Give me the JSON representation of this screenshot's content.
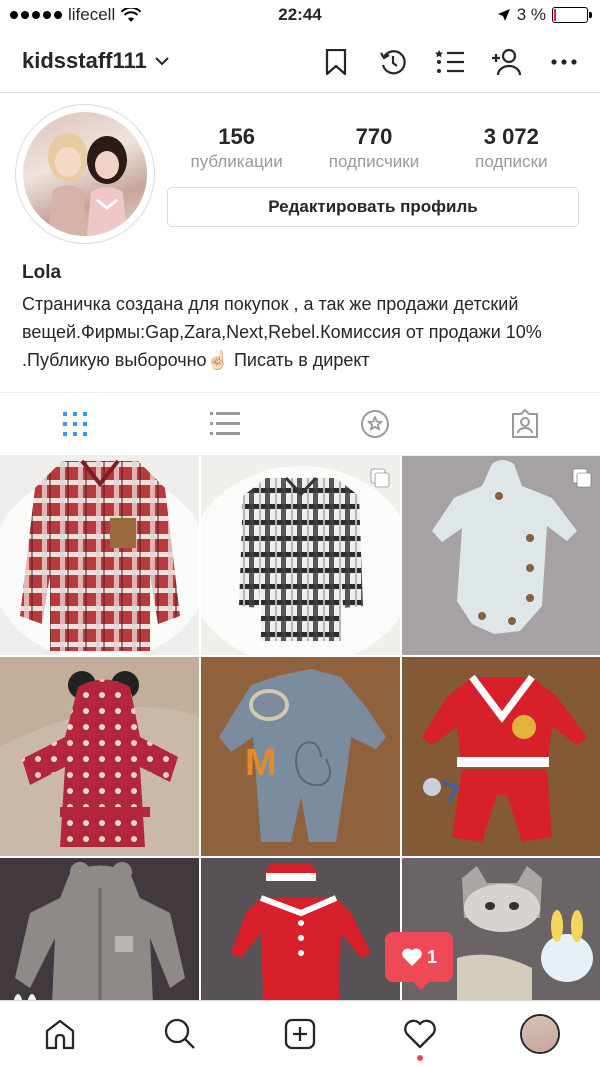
{
  "status_bar": {
    "carrier": "lifecell",
    "time": "22:44",
    "battery": "3 %"
  },
  "header": {
    "username": "kidsstaff111"
  },
  "profile": {
    "stats": [
      {
        "value": "156",
        "label": "публикации"
      },
      {
        "value": "770",
        "label": "подписчики"
      },
      {
        "value": "3 072",
        "label": "подписки"
      }
    ],
    "edit_button": "Редактировать профиль",
    "name": "Lola",
    "bio": "Страничка создана для покупок , а так же продажи детский вещей.Фирмы:Gap,Zara,Next,Rebel.Комиссия от продажи 10% .Публикую выборочно☝🏻 Писать в директ"
  },
  "notification": {
    "likes": "1"
  },
  "colors": {
    "accent": "#3897f0",
    "like": "#ed4956",
    "text": "#262626",
    "muted": "#999999",
    "border": "#dbdbdb"
  },
  "grid_items": [
    {
      "desc": "plaid shirt red",
      "multi": false
    },
    {
      "desc": "plaid shirt black",
      "multi": true
    },
    {
      "desc": "white romper",
      "multi": true
    },
    {
      "desc": "minnie bathrobe",
      "multi": false
    },
    {
      "desc": "mickey jumpsuit",
      "multi": false
    },
    {
      "desc": "santa suit",
      "multi": false
    },
    {
      "desc": "fur overall",
      "multi": false
    },
    {
      "desc": "santa romper",
      "multi": false
    },
    {
      "desc": "winter hats",
      "multi": false
    }
  ]
}
